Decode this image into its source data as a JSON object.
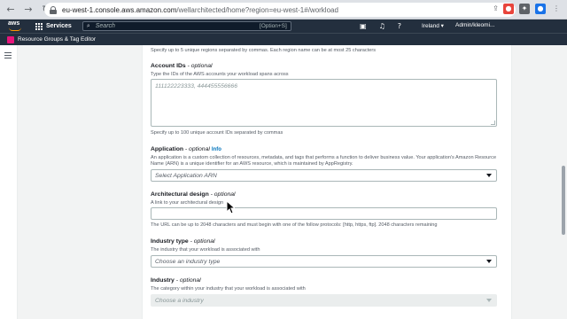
{
  "browser": {
    "url_host": "eu-west-1.console.aws.amazon.com",
    "url_path": "/wellarchitected/home?region=eu-west-1#/workload",
    "back_icon": "back-arrow-icon",
    "forward_icon": "forward-arrow-icon",
    "reload_icon": "reload-icon"
  },
  "aws_nav": {
    "logo": "aws",
    "services_label": "Services",
    "search_placeholder": "Search",
    "search_shortcut": "[Option+S]",
    "region_label": "Ireland ▾",
    "user_label": "Admin/kleomi..."
  },
  "resource_bar": {
    "label": "Resource Groups & Tag Editor"
  },
  "form": {
    "regions_constraint": "Specify up to 5 unique regions separated by commas. Each region name can be at most 25 characters",
    "account_ids": {
      "label": "Account IDs",
      "optional": " - optional",
      "description": "Type the IDs of the AWS accounts your workload spans across",
      "placeholder": "111122223333, 444455556666",
      "constraint": "Specify up to 100 unique account IDs separated by commas"
    },
    "application": {
      "label": "Application",
      "optional": " - optional",
      "info": "Info",
      "description_line1": "An application is a custom collection of resources, metadata, and tags that performs a function to deliver business value. Your application's Amazon Resource",
      "description_line2": "Name (ARN) is a unique identifier for an AWS resource, which is maintained by AppRegistry.",
      "select_value": "Select Application ARN"
    },
    "architectural_design": {
      "label": "Architectural design",
      "optional": " - optional",
      "description": "A link to your architectural design",
      "value": "",
      "constraint": "The URL can be up to 2048 characters and must begin with one of the follow protocols: [http, https, ftp]. 2048 characters remaining"
    },
    "industry_type": {
      "label": "Industry type",
      "optional": " - optional",
      "description": "The industry that your workload is associated with",
      "select_value": "Choose an industry type"
    },
    "industry": {
      "label": "Industry",
      "optional": " - optional",
      "description": "The category within your industry that your workload is associated with",
      "select_value": "Choose a industry"
    }
  }
}
